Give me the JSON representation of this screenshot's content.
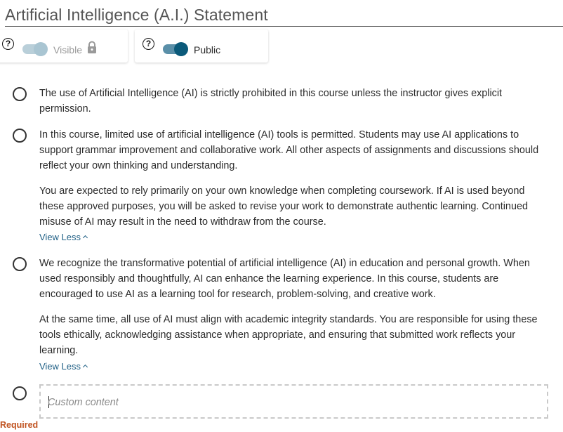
{
  "statement": {
    "title": "Artificial Intelligence (A.I.) Statement"
  },
  "toggles": {
    "visible": {
      "label": "Visible",
      "state": "on",
      "disabled": true,
      "help_icon": "question-circle-icon",
      "lock_icon": "lock-icon"
    },
    "public": {
      "label": "Public",
      "state": "on",
      "disabled": false,
      "help_icon": "question-circle-icon"
    }
  },
  "options": [
    {
      "paragraphs": [
        "The use of Artificial Intelligence (AI) is strictly prohibited in this course unless the instructor gives explicit permission."
      ]
    },
    {
      "paragraphs": [
        "In this course, limited use of artificial intelligence (AI) tools is permitted. Students may use AI applications to support grammar improvement and collaborative work. All other aspects of assignments and discussions should reflect your own thinking and understanding.",
        "You are expected to rely primarily on your own knowledge when completing coursework. If AI is used beyond these approved purposes, you will be asked to revise your work to demonstrate authentic learning. Continued misuse of AI may result in the need to withdraw from the course."
      ],
      "toggle_label": "View Less"
    },
    {
      "paragraphs": [
        "We recognize the transformative potential of artificial intelligence (AI) in education and personal growth. When used responsibly and thoughtfully, AI can enhance the learning experience. In this course, students are encouraged to use AI as a learning tool for research, problem-solving, and creative work.",
        "At the same time, all use of AI must align with academic integrity standards. You are responsible for using these tools ethically, acknowledging assistance when appropriate, and ensuring that submitted work reflects your learning."
      ],
      "toggle_label": "View Less"
    }
  ],
  "custom": {
    "placeholder": "Custom content",
    "value": ""
  },
  "validation": {
    "required_label": "Required"
  },
  "colors": {
    "accent": "#0b5a7a",
    "link": "#1f5f85",
    "required": "#c0521f"
  }
}
